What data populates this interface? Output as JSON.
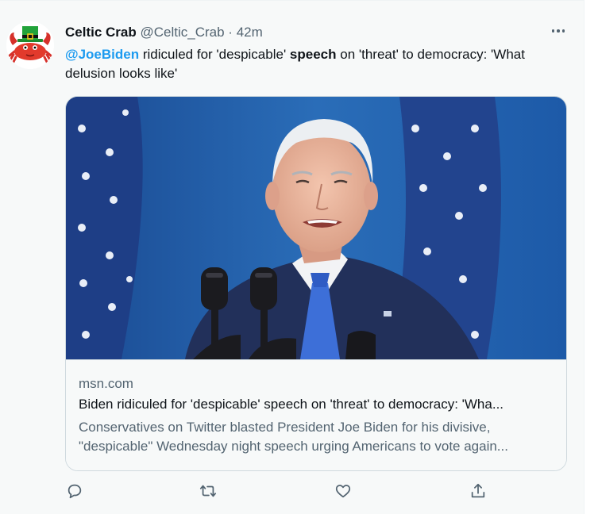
{
  "tweet": {
    "author_name": "Celtic Crab",
    "author_handle": "@Celtic_Crab",
    "separator": "·",
    "time": "42m",
    "more_icon": "more-icon",
    "text": {
      "mention": "@JoeBiden",
      "part1": " ridiculed for 'despicable' ",
      "bold": "speech",
      "part2": " on 'threat' to democracy: 'What delusion looks like'"
    }
  },
  "card": {
    "image_icon": "photo-of-president-at-podium",
    "domain": "msn.com",
    "title": "Biden ridiculed for 'despicable' speech on 'threat' to democracy: 'Wha...",
    "description_line1": "Conservatives on Twitter blasted President Joe Biden for his divisive,",
    "description_line2": "\"despicable\" Wednesday night speech urging Americans to vote again..."
  },
  "actions": [
    {
      "icon": "reply-icon"
    },
    {
      "icon": "retweet-icon"
    },
    {
      "icon": "like-icon"
    },
    {
      "icon": "share-icon"
    }
  ],
  "colors": {
    "accent": "#1d9bf0",
    "text_primary": "#0f1419",
    "text_secondary": "#536471",
    "background": "#f7f9f9",
    "border": "#cfd9de"
  }
}
